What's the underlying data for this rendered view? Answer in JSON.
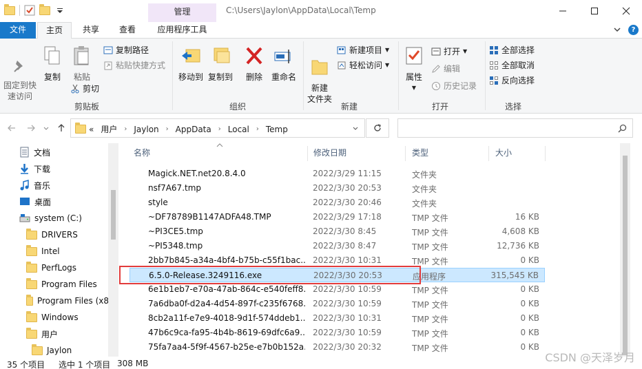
{
  "window": {
    "context_tab": "管理",
    "path": "C:\\Users\\Jaylon\\AppData\\Local\\Temp"
  },
  "tabs": [
    {
      "label": "文件"
    },
    {
      "label": "主页"
    },
    {
      "label": "共享"
    },
    {
      "label": "查看"
    },
    {
      "label": "应用程序工具"
    }
  ],
  "ribbon": {
    "clipboard": {
      "group": "剪贴板",
      "pin": "固定到快\n速访问",
      "copy": "复制",
      "paste": "粘贴",
      "copy_path": "复制路径",
      "paste_shortcut": "粘贴快捷方式",
      "cut": "剪切"
    },
    "organize": {
      "group": "组织",
      "move_to": "移动到",
      "copy_to": "复制到",
      "delete": "删除",
      "rename": "重命名"
    },
    "new": {
      "group": "新建",
      "new_folder": "新建\n文件夹",
      "new_item": "新建项目",
      "easy_access": "轻松访问"
    },
    "open": {
      "group": "打开",
      "properties": "属性",
      "open": "打开",
      "edit": "编辑",
      "history": "历史记录"
    },
    "select": {
      "group": "选择",
      "select_all": "全部选择",
      "select_none": "全部取消",
      "invert": "反向选择"
    }
  },
  "address": {
    "prefix": "«",
    "crumbs": [
      "用户",
      "Jaylon",
      "AppData",
      "Local",
      "Temp"
    ]
  },
  "nav": [
    {
      "label": "文档",
      "icon": "document-icon"
    },
    {
      "label": "下载",
      "icon": "download-icon"
    },
    {
      "label": "音乐",
      "icon": "music-icon"
    },
    {
      "label": "桌面",
      "icon": "desktop-icon"
    },
    {
      "label": "system (C:)",
      "icon": "drive-icon"
    },
    {
      "label": "DRIVERS",
      "icon": "folder-icon"
    },
    {
      "label": "Intel",
      "icon": "folder-icon"
    },
    {
      "label": "PerfLogs",
      "icon": "folder-icon"
    },
    {
      "label": "Program Files",
      "icon": "folder-icon"
    },
    {
      "label": "Program Files (x8",
      "icon": "folder-icon"
    },
    {
      "label": "Windows",
      "icon": "folder-icon"
    },
    {
      "label": "用户",
      "icon": "folder-icon"
    },
    {
      "label": "Jaylon",
      "icon": "folder-icon"
    }
  ],
  "columns": {
    "name": "名称",
    "date": "修改日期",
    "type": "类型",
    "size": "大小"
  },
  "files": [
    {
      "name": "Magick.NET.net20.8.4.0",
      "date": "2022/3/29 11:15",
      "type": "文件夹",
      "size": "",
      "icon": "folder"
    },
    {
      "name": "nsf7A67.tmp",
      "date": "2022/3/30 20:53",
      "type": "文件夹",
      "size": "",
      "icon": "folder"
    },
    {
      "name": "style",
      "date": "2022/3/30 20:46",
      "type": "文件夹",
      "size": "",
      "icon": "folder"
    },
    {
      "name": "~DF78789B1147ADFA48.TMP",
      "date": "2022/3/29 17:18",
      "type": "TMP 文件",
      "size": "16 KB",
      "icon": "doc"
    },
    {
      "name": "~PI3CE5.tmp",
      "date": "2022/3/30 8:45",
      "type": "TMP 文件",
      "size": "4,608 KB",
      "icon": "doc"
    },
    {
      "name": "~PI5348.tmp",
      "date": "2022/3/30 8:47",
      "type": "TMP 文件",
      "size": "12,736 KB",
      "icon": "doc"
    },
    {
      "name": "2bb7b845-a34a-4bf4-b75b-c55f1bac...",
      "date": "2022/3/30 10:31",
      "type": "TMP 文件",
      "size": "0 KB",
      "icon": "doc"
    },
    {
      "name": "6.5.0-Release.3249116.exe",
      "date": "2022/3/30 20:53",
      "type": "应用程序",
      "size": "315,545 KB",
      "icon": "exe"
    },
    {
      "name": "6e1b1eb7-e70a-47ab-864c-e540feff8...",
      "date": "2022/3/30 10:59",
      "type": "TMP 文件",
      "size": "0 KB",
      "icon": "doc"
    },
    {
      "name": "7a6dba0f-d2a4-4d54-897f-c235f6768...",
      "date": "2022/3/30 10:59",
      "type": "TMP 文件",
      "size": "0 KB",
      "icon": "doc"
    },
    {
      "name": "8cb2a11f-e7e9-4018-9d1f-574ddeb1...",
      "date": "2022/3/30 10:31",
      "type": "TMP 文件",
      "size": "0 KB",
      "icon": "doc"
    },
    {
      "name": "47b6c9ca-fa95-4b4b-8619-69dfc6a9...",
      "date": "2022/3/30 10:59",
      "type": "TMP 文件",
      "size": "0 KB",
      "icon": "doc"
    },
    {
      "name": "75fa7aa4-5f9f-4567-b25e-e7b0b152a...",
      "date": "2022/3/30 20:32",
      "type": "TMP 文件",
      "size": "0 KB",
      "icon": "doc"
    }
  ],
  "status": {
    "count": "35 个项目",
    "selected": "选中 1 个项目",
    "size": "308 MB"
  },
  "watermark": "CSDN @天泽岁月",
  "colors": {
    "accent": "#1979ca",
    "selection": "#cce8ff",
    "context_tab": "#f1e6f8",
    "highlight_box": "#e23b3b"
  }
}
